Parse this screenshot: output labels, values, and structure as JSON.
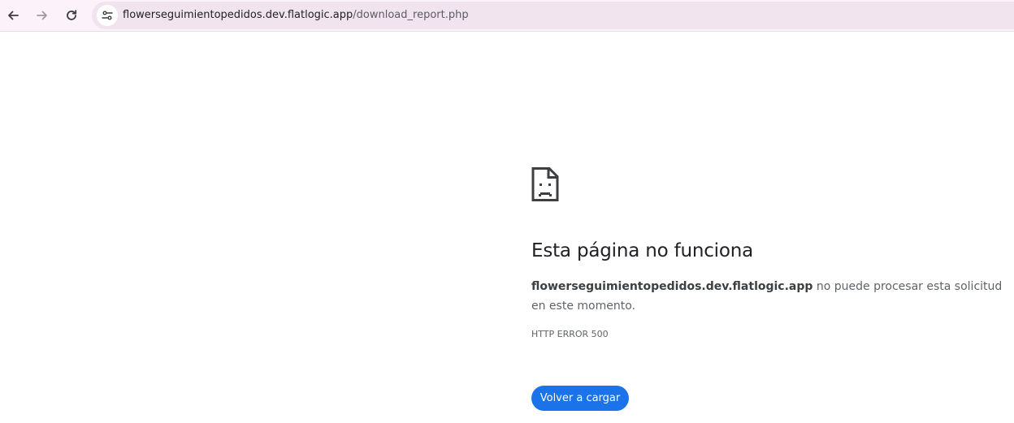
{
  "browser": {
    "url_host": "flowerseguimientopedidos.dev.flatlogic.app",
    "url_path": "/download_report.php",
    "icons": {
      "back": "arrow-left-icon",
      "forward": "arrow-right-icon",
      "reload": "reload-icon",
      "site_info": "tune-icon"
    }
  },
  "error_page": {
    "icon": "sad-document-icon",
    "title": "Esta página no funciona",
    "message_domain": "flowerseguimientopedidos.dev.flatlogic.app",
    "message_rest": " no puede procesar esta solicitud en este momento.",
    "error_code": "HTTP ERROR 500",
    "reload_button": "Volver a cargar"
  },
  "colors": {
    "toolbar_bg": "#fbf3f9",
    "omnibox_bg": "#f1e4ef",
    "button_blue": "#1a73e8",
    "title_text": "#202124",
    "body_text": "#5f6368"
  }
}
